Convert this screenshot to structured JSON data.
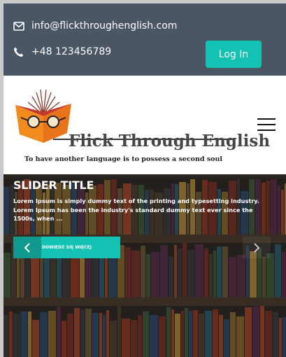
{
  "topbar": {
    "email": "info@flickthroughenglish.com",
    "phone": "+48 123456789",
    "login_label": "Log In"
  },
  "header": {
    "brand": "Flick Through English",
    "tagline": "To have another language is to possess a second soul"
  },
  "slider": {
    "title": "SLIDER TITLE",
    "text": "Lorem Ipsum is simply dummy text of the printing and typesetting industry. Lorem Ipsum has been the industry's standard dummy text ever since the 1500s, when ...",
    "cta_label": "DOWIEDZ SIĘ WIĘCEJ"
  },
  "colors": {
    "topbar": "#4b5665",
    "accent": "#14c2b3",
    "logo_orange": "#f28a1e",
    "logo_red": "#c0392b"
  },
  "icons": [
    "envelope-icon",
    "phone-icon",
    "hamburger-menu-icon",
    "chevron-left-icon",
    "chevron-right-icon"
  ]
}
